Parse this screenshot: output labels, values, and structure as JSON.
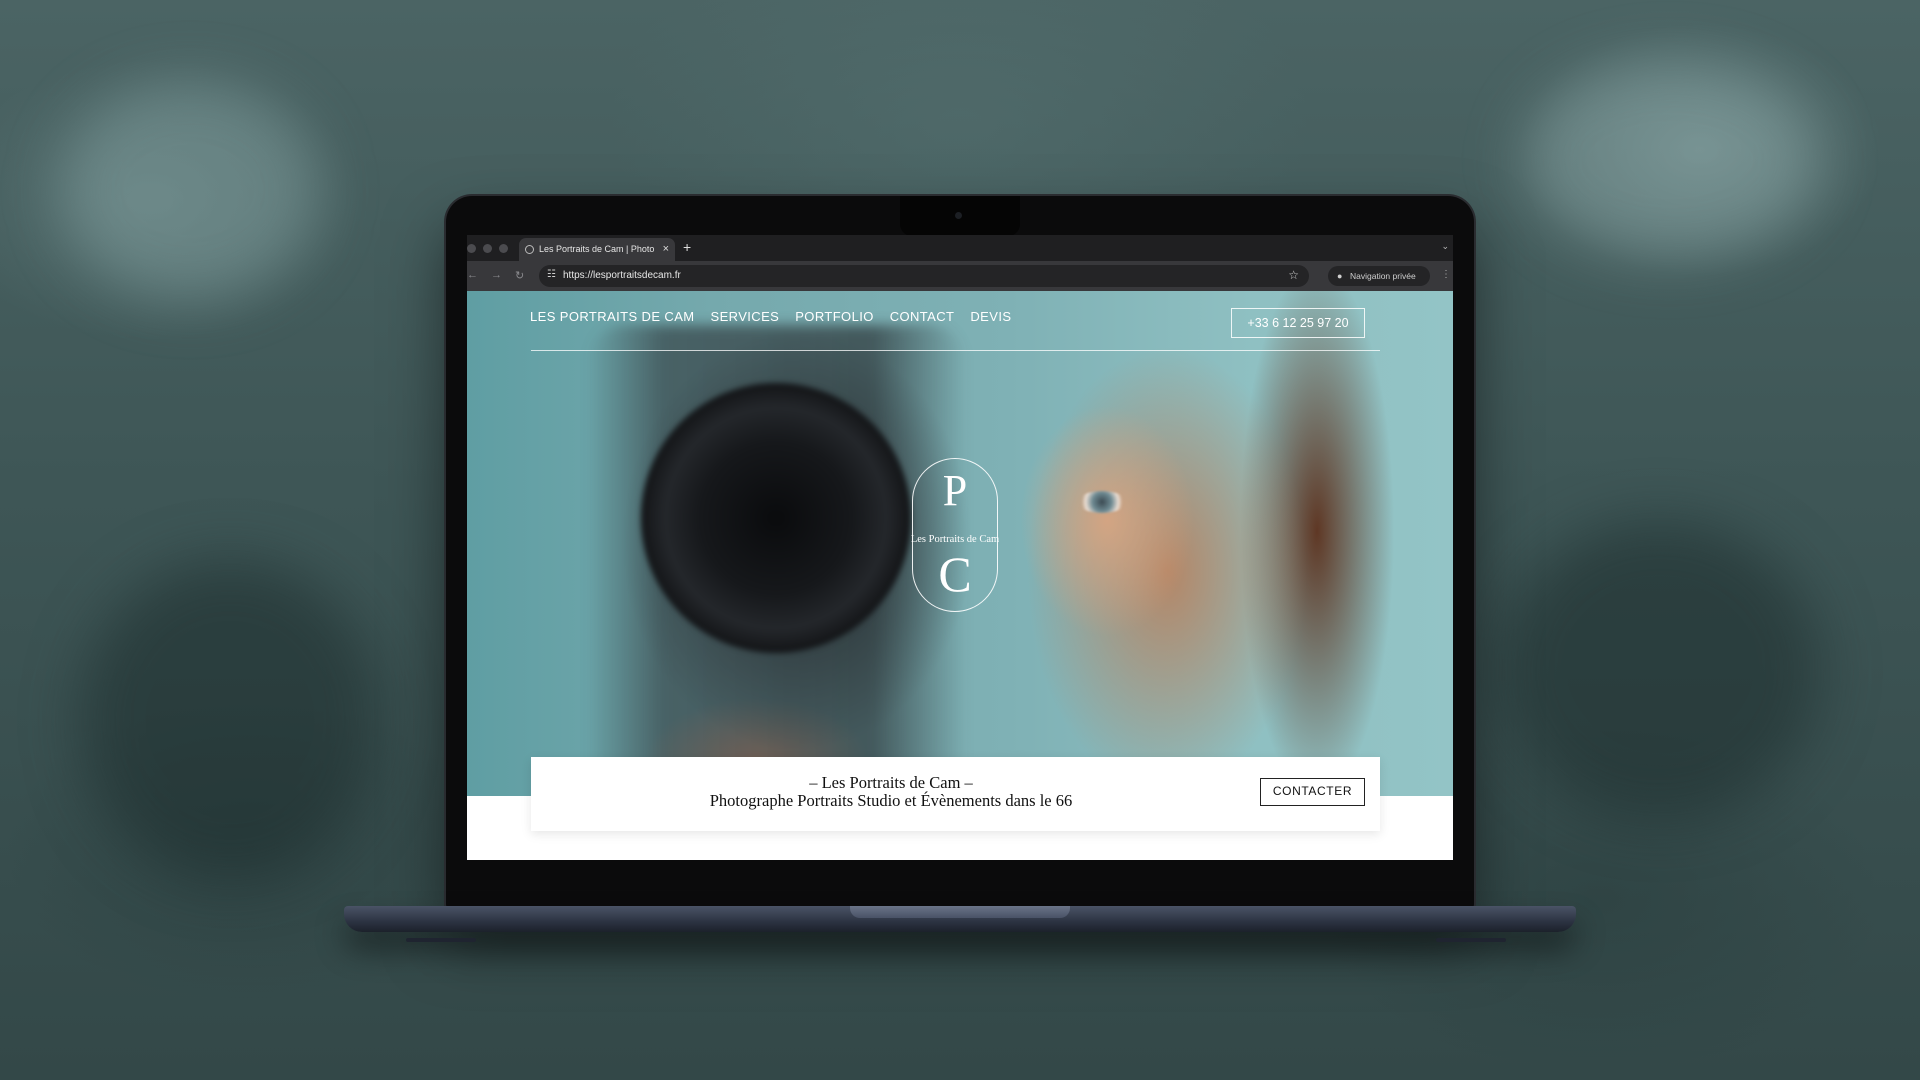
{
  "browser": {
    "tab_title": "Les Portraits de Cam | Photo",
    "tab_close": "×",
    "new_tab": "+",
    "url": "https://lesportraitsdecam.fr",
    "private_label": "Navigation privée"
  },
  "site": {
    "nav": [
      "LES PORTRAITS DE CAM",
      "SERVICES",
      "PORTFOLIO",
      "CONTACT",
      "DEVIS"
    ],
    "phone": "+33 6 12 25 97 20",
    "logo": {
      "top_letter": "P",
      "name": "Les Portraits de Cam",
      "bottom_letter": "C"
    },
    "banner": {
      "title": "– Les Portraits de Cam –",
      "subtitle": "Photographe Portraits Studio et Évènements dans le 66",
      "cta": "CONTACTER"
    }
  },
  "icons": {
    "back": "back-arrow-icon",
    "forward": "forward-arrow-icon",
    "reload": "reload-icon",
    "site_info": "tune-icon",
    "bookmark": "star-icon",
    "incognito": "incognito-icon",
    "menu": "kebab-menu-icon"
  }
}
